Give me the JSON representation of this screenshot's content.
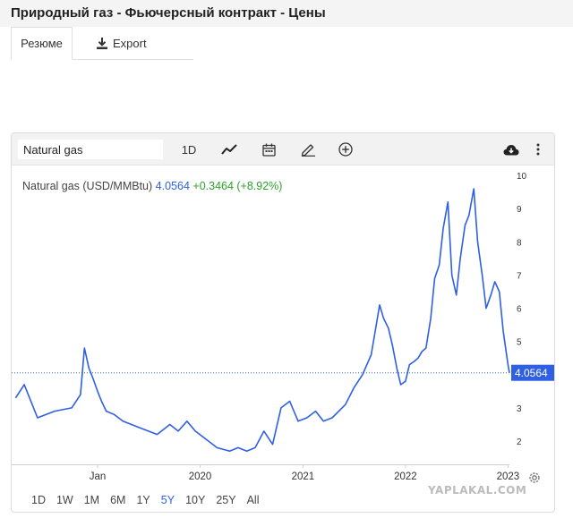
{
  "page": {
    "title": "Природный газ - Фьючерсный контракт - Цены"
  },
  "tabs": [
    {
      "label": "Резюме",
      "active": true
    },
    {
      "label": "Export",
      "icon": "download-icon"
    }
  ],
  "toolbar": {
    "symbol_value": "Natural gas",
    "interval_label": "1D",
    "icons": [
      "line-chart-icon",
      "calendar-icon",
      "pencil-icon",
      "plus-circle-icon",
      "cloud-download-icon",
      "more-vertical-icon"
    ]
  },
  "legend": {
    "name": "Natural gas (USD/MMBtu)",
    "price": "4.0564",
    "change": "+0.3464 (+8.92%)",
    "price_color": "#2f5fe3",
    "change_color": "#2ca02c"
  },
  "ranges": [
    {
      "label": "1D"
    },
    {
      "label": "1W"
    },
    {
      "label": "1M"
    },
    {
      "label": "6M"
    },
    {
      "label": "1Y"
    },
    {
      "label": "5Y",
      "active": true
    },
    {
      "label": "10Y"
    },
    {
      "label": "25Y"
    },
    {
      "label": "All"
    }
  ],
  "watermark": "YAPLAKAL.COM",
  "chart_data": {
    "type": "line",
    "series": [
      {
        "name": "Natural gas",
        "color": "#2f5fe3",
        "x": [
          "2018-03-15",
          "2018-04-15",
          "2018-06-01",
          "2018-08-01",
          "2018-10-01",
          "2018-11-01",
          "2018-11-15",
          "2018-12-01",
          "2018-12-15",
          "2019-01-01",
          "2019-01-15",
          "2019-02-01",
          "2019-03-01",
          "2019-04-01",
          "2019-06-01",
          "2019-08-01",
          "2019-09-15",
          "2019-10-15",
          "2019-11-15",
          "2019-12-15",
          "2020-01-15",
          "2020-03-01",
          "2020-04-15",
          "2020-05-15",
          "2020-06-15",
          "2020-07-15",
          "2020-08-15",
          "2020-09-15",
          "2020-10-15",
          "2020-11-15",
          "2020-12-15",
          "2021-01-15",
          "2021-02-15",
          "2021-03-15",
          "2021-04-15",
          "2021-06-01",
          "2021-07-01",
          "2021-08-01",
          "2021-09-01",
          "2021-09-15",
          "2021-10-01",
          "2021-10-15",
          "2021-11-01",
          "2021-11-15",
          "2021-12-01",
          "2021-12-15",
          "2022-01-01",
          "2022-01-15",
          "2022-02-01",
          "2022-02-15",
          "2022-03-01",
          "2022-03-15",
          "2022-04-01",
          "2022-04-15",
          "2022-05-01",
          "2022-05-15",
          "2022-06-01",
          "2022-06-15",
          "2022-07-01",
          "2022-07-15",
          "2022-08-01",
          "2022-08-15",
          "2022-09-01",
          "2022-09-15",
          "2022-10-01",
          "2022-10-15",
          "2022-11-01",
          "2022-11-15",
          "2022-12-01",
          "2022-12-15",
          "2023-01-01",
          "2023-01-06"
        ],
        "y": [
          3.3,
          3.7,
          2.7,
          2.9,
          3.0,
          3.4,
          4.8,
          4.2,
          3.9,
          3.5,
          3.2,
          2.9,
          2.8,
          2.6,
          2.4,
          2.2,
          2.5,
          2.3,
          2.6,
          2.3,
          2.1,
          1.8,
          1.7,
          1.8,
          1.7,
          1.8,
          2.3,
          1.9,
          3.0,
          3.2,
          2.6,
          2.7,
          2.9,
          2.6,
          2.7,
          3.1,
          3.6,
          4.0,
          4.6,
          5.3,
          6.1,
          5.7,
          5.4,
          4.9,
          4.2,
          3.7,
          3.8,
          4.3,
          4.4,
          4.5,
          4.7,
          4.8,
          5.7,
          6.9,
          7.3,
          8.4,
          9.2,
          7.0,
          6.4,
          7.5,
          8.5,
          8.8,
          9.6,
          8.0,
          7.0,
          6.0,
          6.4,
          6.8,
          6.5,
          5.3,
          4.3,
          4.0564
        ]
      }
    ],
    "last_value": 4.0564,
    "xlabel": "",
    "ylabel": "",
    "ylim": [
      1.3,
      10.3
    ],
    "yticks": [
      2,
      3,
      4,
      5,
      6,
      7,
      8,
      9,
      10
    ],
    "xtick_labels": [
      {
        "date": "2019-01-01",
        "label": "Jan"
      },
      {
        "date": "2020-01-01",
        "label": "2020"
      },
      {
        "date": "2021-01-01",
        "label": "2021"
      },
      {
        "date": "2022-01-01",
        "label": "2022"
      },
      {
        "date": "2023-01-01",
        "label": "2023"
      }
    ],
    "x_range": [
      "2018-03-01",
      "2023-01-06"
    ],
    "y_axis_position": "right",
    "price_line": "dotted",
    "grid": false
  }
}
